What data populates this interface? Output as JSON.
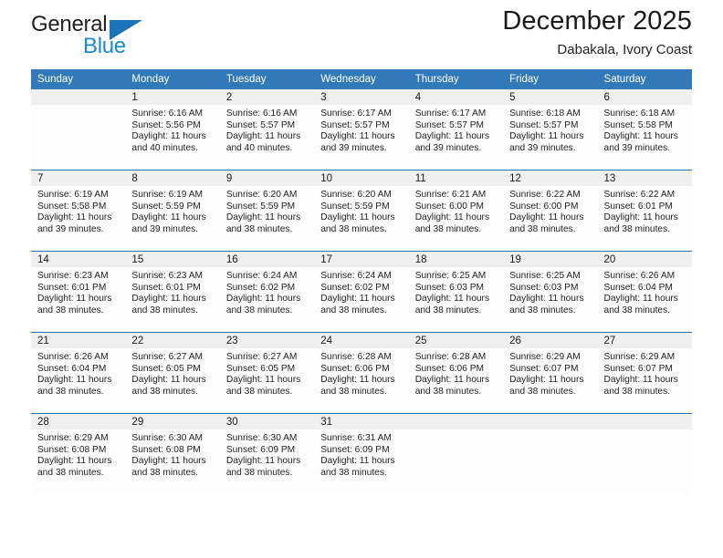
{
  "brand": {
    "name_part1": "General",
    "name_part2": "Blue",
    "triangle_color": "#1b74bb",
    "blue_color": "#1b8ad1"
  },
  "header": {
    "title": "December 2025",
    "location": "Dabakala, Ivory Coast"
  },
  "theme": {
    "header_blue": "#3179b9",
    "row_divider_blue": "#2e71ad",
    "daynum_band": "#efefef",
    "cell_background": "#fdfdfd"
  },
  "weekday_headers": [
    "Sunday",
    "Monday",
    "Tuesday",
    "Wednesday",
    "Thursday",
    "Friday",
    "Saturday"
  ],
  "labels": {
    "sunrise_prefix": "Sunrise:",
    "sunset_prefix": "Sunset:",
    "daylight_prefix": "Daylight:"
  },
  "weeks": [
    [
      {
        "day": "",
        "sunrise": "",
        "sunset": "",
        "daylight_line1": "",
        "daylight_line2": ""
      },
      {
        "day": "1",
        "sunrise": "Sunrise: 6:16 AM",
        "sunset": "Sunset: 5:56 PM",
        "daylight_line1": "Daylight: 11 hours",
        "daylight_line2": "and 40 minutes."
      },
      {
        "day": "2",
        "sunrise": "Sunrise: 6:16 AM",
        "sunset": "Sunset: 5:57 PM",
        "daylight_line1": "Daylight: 11 hours",
        "daylight_line2": "and 40 minutes."
      },
      {
        "day": "3",
        "sunrise": "Sunrise: 6:17 AM",
        "sunset": "Sunset: 5:57 PM",
        "daylight_line1": "Daylight: 11 hours",
        "daylight_line2": "and 39 minutes."
      },
      {
        "day": "4",
        "sunrise": "Sunrise: 6:17 AM",
        "sunset": "Sunset: 5:57 PM",
        "daylight_line1": "Daylight: 11 hours",
        "daylight_line2": "and 39 minutes."
      },
      {
        "day": "5",
        "sunrise": "Sunrise: 6:18 AM",
        "sunset": "Sunset: 5:57 PM",
        "daylight_line1": "Daylight: 11 hours",
        "daylight_line2": "and 39 minutes."
      },
      {
        "day": "6",
        "sunrise": "Sunrise: 6:18 AM",
        "sunset": "Sunset: 5:58 PM",
        "daylight_line1": "Daylight: 11 hours",
        "daylight_line2": "and 39 minutes."
      }
    ],
    [
      {
        "day": "7",
        "sunrise": "Sunrise: 6:19 AM",
        "sunset": "Sunset: 5:58 PM",
        "daylight_line1": "Daylight: 11 hours",
        "daylight_line2": "and 39 minutes."
      },
      {
        "day": "8",
        "sunrise": "Sunrise: 6:19 AM",
        "sunset": "Sunset: 5:59 PM",
        "daylight_line1": "Daylight: 11 hours",
        "daylight_line2": "and 39 minutes."
      },
      {
        "day": "9",
        "sunrise": "Sunrise: 6:20 AM",
        "sunset": "Sunset: 5:59 PM",
        "daylight_line1": "Daylight: 11 hours",
        "daylight_line2": "and 38 minutes."
      },
      {
        "day": "10",
        "sunrise": "Sunrise: 6:20 AM",
        "sunset": "Sunset: 5:59 PM",
        "daylight_line1": "Daylight: 11 hours",
        "daylight_line2": "and 38 minutes."
      },
      {
        "day": "11",
        "sunrise": "Sunrise: 6:21 AM",
        "sunset": "Sunset: 6:00 PM",
        "daylight_line1": "Daylight: 11 hours",
        "daylight_line2": "and 38 minutes."
      },
      {
        "day": "12",
        "sunrise": "Sunrise: 6:22 AM",
        "sunset": "Sunset: 6:00 PM",
        "daylight_line1": "Daylight: 11 hours",
        "daylight_line2": "and 38 minutes."
      },
      {
        "day": "13",
        "sunrise": "Sunrise: 6:22 AM",
        "sunset": "Sunset: 6:01 PM",
        "daylight_line1": "Daylight: 11 hours",
        "daylight_line2": "and 38 minutes."
      }
    ],
    [
      {
        "day": "14",
        "sunrise": "Sunrise: 6:23 AM",
        "sunset": "Sunset: 6:01 PM",
        "daylight_line1": "Daylight: 11 hours",
        "daylight_line2": "and 38 minutes."
      },
      {
        "day": "15",
        "sunrise": "Sunrise: 6:23 AM",
        "sunset": "Sunset: 6:01 PM",
        "daylight_line1": "Daylight: 11 hours",
        "daylight_line2": "and 38 minutes."
      },
      {
        "day": "16",
        "sunrise": "Sunrise: 6:24 AM",
        "sunset": "Sunset: 6:02 PM",
        "daylight_line1": "Daylight: 11 hours",
        "daylight_line2": "and 38 minutes."
      },
      {
        "day": "17",
        "sunrise": "Sunrise: 6:24 AM",
        "sunset": "Sunset: 6:02 PM",
        "daylight_line1": "Daylight: 11 hours",
        "daylight_line2": "and 38 minutes."
      },
      {
        "day": "18",
        "sunrise": "Sunrise: 6:25 AM",
        "sunset": "Sunset: 6:03 PM",
        "daylight_line1": "Daylight: 11 hours",
        "daylight_line2": "and 38 minutes."
      },
      {
        "day": "19",
        "sunrise": "Sunrise: 6:25 AM",
        "sunset": "Sunset: 6:03 PM",
        "daylight_line1": "Daylight: 11 hours",
        "daylight_line2": "and 38 minutes."
      },
      {
        "day": "20",
        "sunrise": "Sunrise: 6:26 AM",
        "sunset": "Sunset: 6:04 PM",
        "daylight_line1": "Daylight: 11 hours",
        "daylight_line2": "and 38 minutes."
      }
    ],
    [
      {
        "day": "21",
        "sunrise": "Sunrise: 6:26 AM",
        "sunset": "Sunset: 6:04 PM",
        "daylight_line1": "Daylight: 11 hours",
        "daylight_line2": "and 38 minutes."
      },
      {
        "day": "22",
        "sunrise": "Sunrise: 6:27 AM",
        "sunset": "Sunset: 6:05 PM",
        "daylight_line1": "Daylight: 11 hours",
        "daylight_line2": "and 38 minutes."
      },
      {
        "day": "23",
        "sunrise": "Sunrise: 6:27 AM",
        "sunset": "Sunset: 6:05 PM",
        "daylight_line1": "Daylight: 11 hours",
        "daylight_line2": "and 38 minutes."
      },
      {
        "day": "24",
        "sunrise": "Sunrise: 6:28 AM",
        "sunset": "Sunset: 6:06 PM",
        "daylight_line1": "Daylight: 11 hours",
        "daylight_line2": "and 38 minutes."
      },
      {
        "day": "25",
        "sunrise": "Sunrise: 6:28 AM",
        "sunset": "Sunset: 6:06 PM",
        "daylight_line1": "Daylight: 11 hours",
        "daylight_line2": "and 38 minutes."
      },
      {
        "day": "26",
        "sunrise": "Sunrise: 6:29 AM",
        "sunset": "Sunset: 6:07 PM",
        "daylight_line1": "Daylight: 11 hours",
        "daylight_line2": "and 38 minutes."
      },
      {
        "day": "27",
        "sunrise": "Sunrise: 6:29 AM",
        "sunset": "Sunset: 6:07 PM",
        "daylight_line1": "Daylight: 11 hours",
        "daylight_line2": "and 38 minutes."
      }
    ],
    [
      {
        "day": "28",
        "sunrise": "Sunrise: 6:29 AM",
        "sunset": "Sunset: 6:08 PM",
        "daylight_line1": "Daylight: 11 hours",
        "daylight_line2": "and 38 minutes."
      },
      {
        "day": "29",
        "sunrise": "Sunrise: 6:30 AM",
        "sunset": "Sunset: 6:08 PM",
        "daylight_line1": "Daylight: 11 hours",
        "daylight_line2": "and 38 minutes."
      },
      {
        "day": "30",
        "sunrise": "Sunrise: 6:30 AM",
        "sunset": "Sunset: 6:09 PM",
        "daylight_line1": "Daylight: 11 hours",
        "daylight_line2": "and 38 minutes."
      },
      {
        "day": "31",
        "sunrise": "Sunrise: 6:31 AM",
        "sunset": "Sunset: 6:09 PM",
        "daylight_line1": "Daylight: 11 hours",
        "daylight_line2": "and 38 minutes."
      },
      {
        "day": "",
        "sunrise": "",
        "sunset": "",
        "daylight_line1": "",
        "daylight_line2": ""
      },
      {
        "day": "",
        "sunrise": "",
        "sunset": "",
        "daylight_line1": "",
        "daylight_line2": ""
      },
      {
        "day": "",
        "sunrise": "",
        "sunset": "",
        "daylight_line1": "",
        "daylight_line2": ""
      }
    ]
  ]
}
